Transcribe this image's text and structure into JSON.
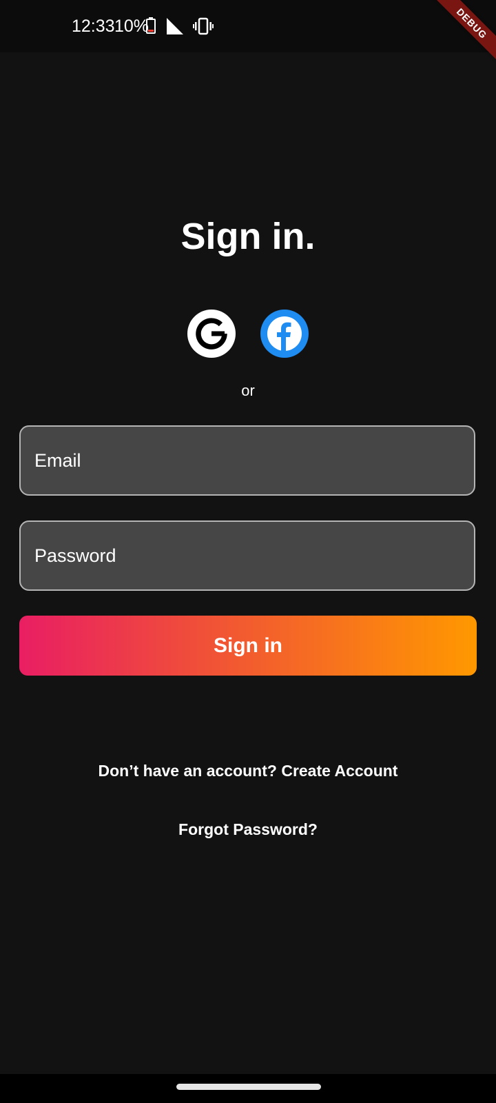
{
  "status_bar": {
    "time": "12:33",
    "battery_percent": "10%",
    "icons": [
      "battery-low-icon",
      "signal-icon",
      "vibrate-icon"
    ],
    "debug_label": "DEBUG"
  },
  "screen": {
    "title": "Sign in.",
    "social_buttons": [
      {
        "name": "google",
        "icon": "google-icon",
        "color": "#ffffff"
      },
      {
        "name": "facebook",
        "icon": "facebook-icon",
        "color": "#1e8cf0"
      }
    ],
    "divider_text": "or"
  },
  "form": {
    "email_placeholder": "Email",
    "password_placeholder": "Password",
    "submit_label": "Sign in",
    "submit_gradient": [
      "#e91e63",
      "#ff9800"
    ]
  },
  "links": {
    "create_account": "Don’t have an account? Create Account",
    "forgot_password": "Forgot Password?"
  },
  "colors": {
    "background": "#121212",
    "input_background": "#464646",
    "input_border": "#b5b5b5"
  }
}
